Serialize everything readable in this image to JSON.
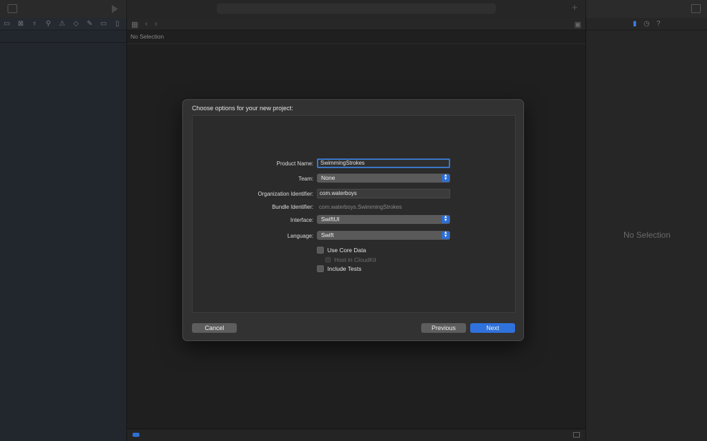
{
  "editor": {
    "path_bar_text": "No Selection"
  },
  "inspector": {
    "no_selection": "No Selection"
  },
  "dialog": {
    "title": "Choose options for your new project:",
    "fields": {
      "product_name_label": "Product Name:",
      "product_name_value": "SwimmingStrokes",
      "team_label": "Team:",
      "team_value": "None",
      "org_id_label": "Organization Identifier:",
      "org_id_value": "com.waterboys",
      "bundle_id_label": "Bundle Identifier:",
      "bundle_id_value": "com.waterboys.SwimmingStrokes",
      "interface_label": "Interface:",
      "interface_value": "SwiftUI",
      "language_label": "Language:",
      "language_value": "Swift"
    },
    "checkboxes": {
      "use_core_data": "Use Core Data",
      "host_in_cloudkit": "Host in CloudKit",
      "include_tests": "Include Tests"
    },
    "buttons": {
      "cancel": "Cancel",
      "previous": "Previous",
      "next": "Next"
    }
  },
  "colors": {
    "accent": "#2f72dc",
    "focus_ring": "#3a78c9"
  }
}
